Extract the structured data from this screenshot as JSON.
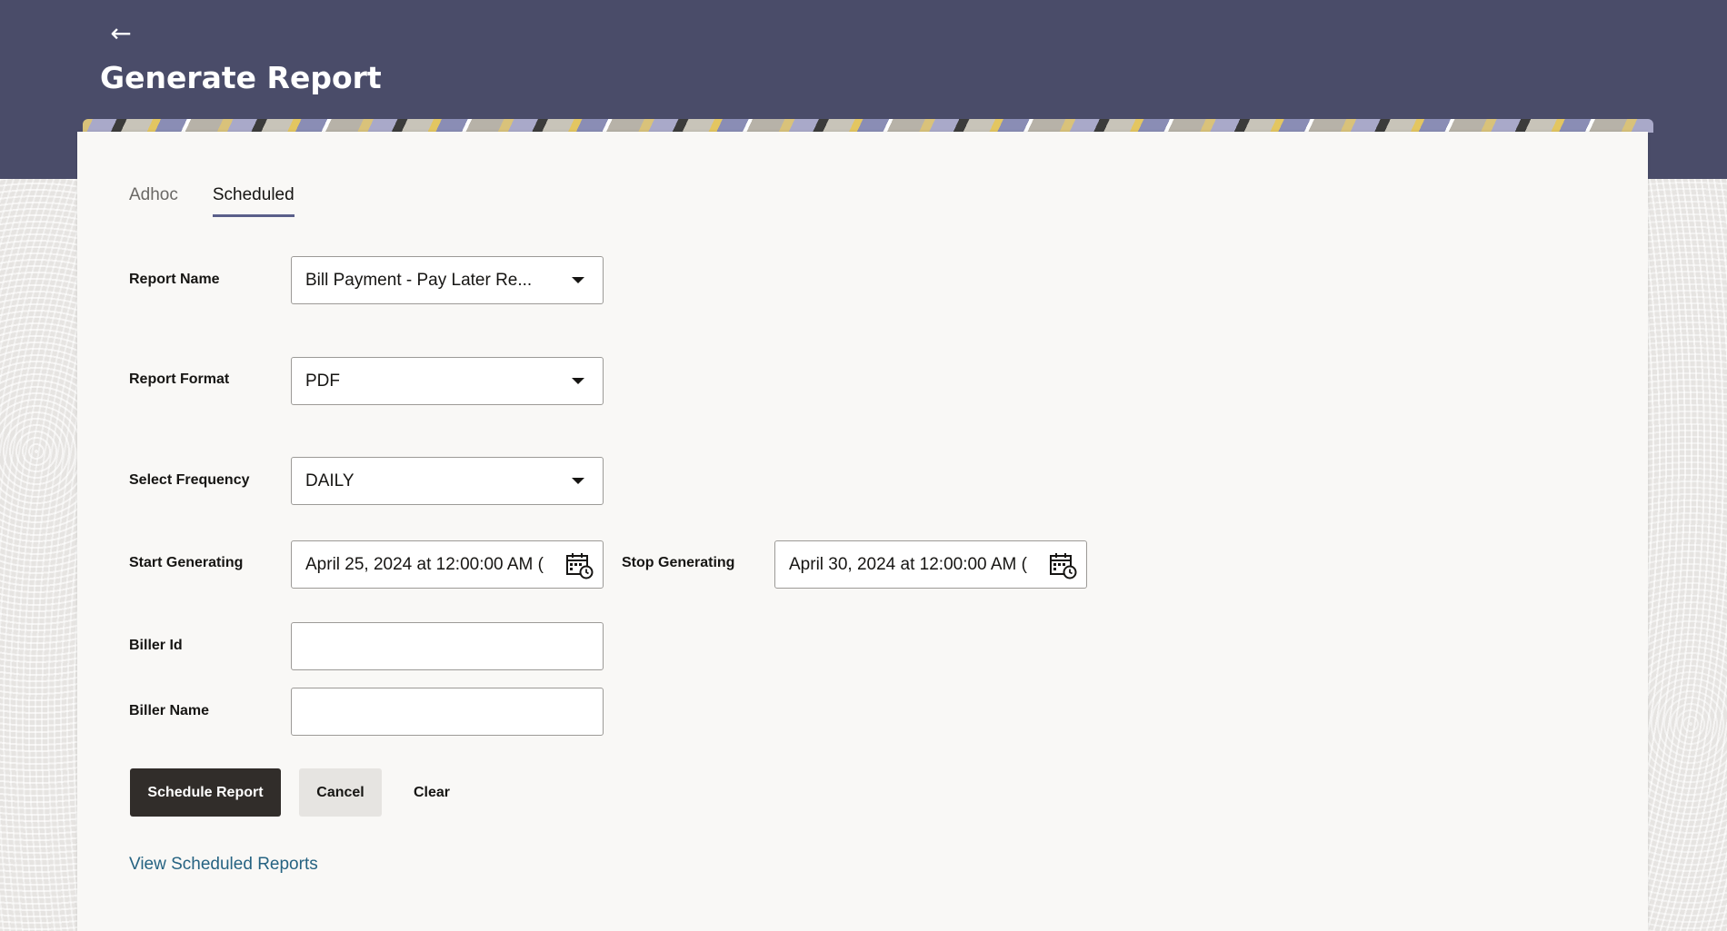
{
  "header": {
    "back_icon": "arrow-left-icon",
    "title": "Generate Report",
    "color": "#4a4c69"
  },
  "tabs": [
    {
      "label": "Adhoc",
      "active": false
    },
    {
      "label": "Scheduled",
      "active": true
    }
  ],
  "form": {
    "report_name": {
      "label": "Report Name",
      "value": "Bill Payment - Pay Later Re..."
    },
    "report_format": {
      "label": "Report Format",
      "value": "PDF"
    },
    "frequency": {
      "label": "Select Frequency",
      "value": "DAILY"
    },
    "start": {
      "label": "Start Generating",
      "value": "April 25, 2024 at 12:00:00 AM (",
      "icon": "calendar-icon"
    },
    "stop": {
      "label": "Stop Generating",
      "value": "April 30, 2024 at 12:00:00 AM (",
      "icon": "calendar-icon"
    },
    "biller_id": {
      "label": "Biller Id",
      "value": ""
    },
    "biller_name": {
      "label": "Biller Name",
      "value": ""
    }
  },
  "actions": {
    "schedule": "Schedule Report",
    "cancel": "Cancel",
    "clear": "Clear"
  },
  "link": {
    "view_scheduled": "View Scheduled Reports"
  },
  "colors": {
    "primary_button": "#312d2a",
    "link": "#266382",
    "tab_underline": "#5a5f8a"
  }
}
